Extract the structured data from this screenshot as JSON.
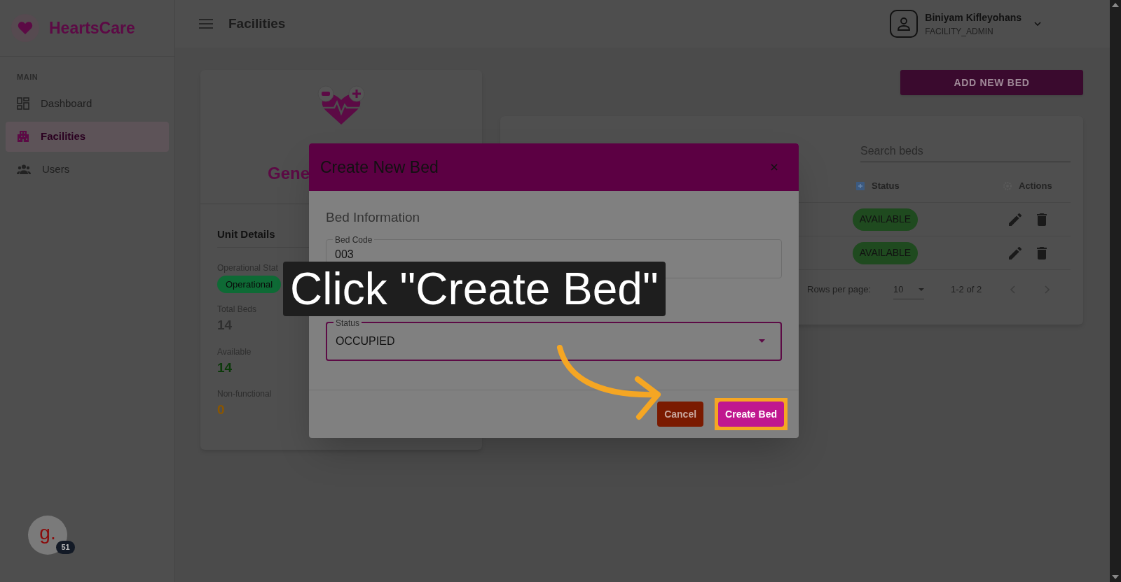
{
  "sidebar": {
    "brand": "HeartsCare",
    "section": "MAIN",
    "items": [
      {
        "label": "Dashboard",
        "selected": false,
        "kind": "grid"
      },
      {
        "label": "Facilities",
        "selected": true,
        "kind": "building"
      },
      {
        "label": "Users",
        "selected": false,
        "kind": "people"
      }
    ]
  },
  "header": {
    "title": "Facilities",
    "user": {
      "name": "Biniyam Kifleyohans",
      "role": "FACILITY_ADMIN"
    }
  },
  "unit_card": {
    "title": "Gene",
    "section": "Unit Details",
    "status_label": "Operational Stat",
    "status": "Operational",
    "stats": [
      {
        "label": "Total Beds",
        "value": "14",
        "color": "#2f2f2f"
      },
      {
        "label": "Available",
        "value": "14",
        "color": "#0c3a0a"
      },
      {
        "label": "Non-functional",
        "value": "0",
        "color": "#8a5600"
      }
    ]
  },
  "add_button": "ADD NEW BED",
  "beds_table": {
    "search_placeholder": "Search beds",
    "columns": [
      "Status",
      "Actions"
    ],
    "rows": [
      {
        "status": "AVAILABLE"
      },
      {
        "status": "AVAILABLE"
      }
    ],
    "pagination": {
      "rows_per_page_label": "Rows per page:",
      "rows_per_page": "10",
      "range": "1-2 of 2"
    }
  },
  "dialog": {
    "title": "Create New Bed",
    "section": "Bed Information",
    "fields": [
      {
        "label": "Bed Code",
        "value": "003",
        "kind": "text",
        "focused": false
      },
      {
        "label": "Status",
        "value": "OCCUPIED",
        "kind": "select",
        "focused": true
      }
    ],
    "buttons": [
      {
        "label": "Cancel",
        "kind": "cancel",
        "highlighted": false
      },
      {
        "label": "Create Bed",
        "kind": "primary",
        "highlighted": true
      }
    ]
  },
  "tooltip": {
    "text": "Click \"Create Bed\""
  },
  "widget": {
    "letter": "g.",
    "badge": "51"
  }
}
